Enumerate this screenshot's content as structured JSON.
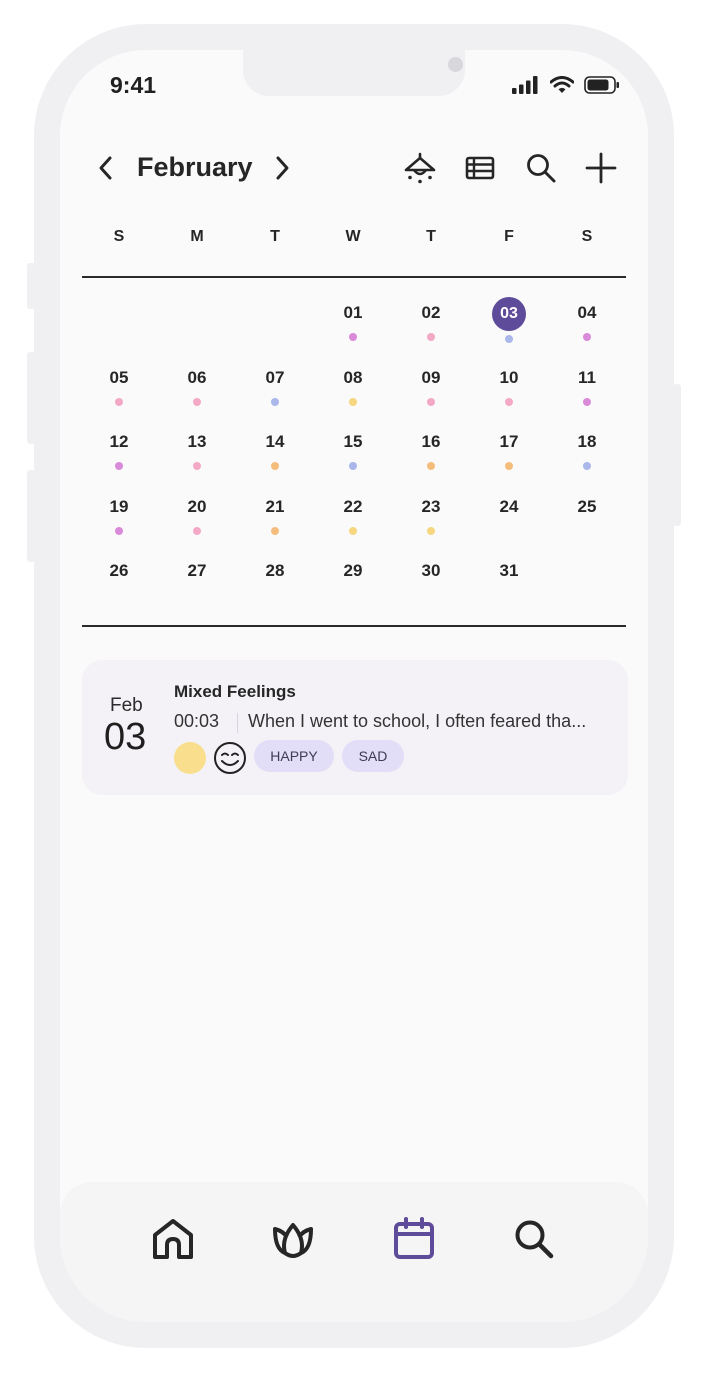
{
  "status": {
    "time": "9:41"
  },
  "header": {
    "month": "February",
    "icons": [
      "chevron-left-icon",
      "chevron-right-icon",
      "lamp-icon",
      "list-view-icon",
      "search-icon",
      "add-icon"
    ]
  },
  "weekdays": [
    "S",
    "M",
    "T",
    "W",
    "T",
    "F",
    "S"
  ],
  "calendar": {
    "selected_day": "03",
    "days": [
      {
        "n": "",
        "dot": null
      },
      {
        "n": "",
        "dot": null
      },
      {
        "n": "",
        "dot": null
      },
      {
        "n": "01",
        "dot": "#d98ad9"
      },
      {
        "n": "02",
        "dot": "#f3a9c6"
      },
      {
        "n": "03",
        "dot": "#a9b7ea"
      },
      {
        "n": "04",
        "dot": "#d98ad9"
      },
      {
        "n": "05",
        "dot": "#f3a9c6"
      },
      {
        "n": "06",
        "dot": "#f3a9c6"
      },
      {
        "n": "07",
        "dot": "#a9b7ea"
      },
      {
        "n": "08",
        "dot": "#f6d67e"
      },
      {
        "n": "09",
        "dot": "#f3a9c6"
      },
      {
        "n": "10",
        "dot": "#f3a9c6"
      },
      {
        "n": "11",
        "dot": "#d98ad9"
      },
      {
        "n": "12",
        "dot": "#d98ad9"
      },
      {
        "n": "13",
        "dot": "#f3a9c6"
      },
      {
        "n": "14",
        "dot": "#f5bd7c"
      },
      {
        "n": "15",
        "dot": "#a9b7ea"
      },
      {
        "n": "16",
        "dot": "#f5bd7c"
      },
      {
        "n": "17",
        "dot": "#f5bd7c"
      },
      {
        "n": "18",
        "dot": "#a9b7ea"
      },
      {
        "n": "19",
        "dot": "#d98ad9"
      },
      {
        "n": "20",
        "dot": "#f3a9c6"
      },
      {
        "n": "21",
        "dot": "#f5bd7c"
      },
      {
        "n": "22",
        "dot": "#f6d67e"
      },
      {
        "n": "23",
        "dot": "#f6d67e"
      },
      {
        "n": "24",
        "dot": null
      },
      {
        "n": "25",
        "dot": null
      },
      {
        "n": "26",
        "dot": null
      },
      {
        "n": "27",
        "dot": null
      },
      {
        "n": "28",
        "dot": null
      },
      {
        "n": "29",
        "dot": null
      },
      {
        "n": "30",
        "dot": null
      },
      {
        "n": "31",
        "dot": null
      }
    ]
  },
  "entry": {
    "month": "Feb",
    "day": "03",
    "title": "Mixed Feelings",
    "time": "00:03",
    "snippet": "When I went to school, I often feared tha...",
    "mood_color": "#f9de8e",
    "tags": [
      "HAPPY",
      "SAD"
    ]
  },
  "tabbar": {
    "items": [
      "home-icon",
      "lotus-icon",
      "calendar-icon",
      "search-icon"
    ],
    "active": "calendar-icon",
    "active_color": "#5e4b9a"
  },
  "colors": {
    "accent": "#5e4b9a",
    "tag_bg": "#e2def7",
    "card_bg": "#f4f2f6"
  }
}
